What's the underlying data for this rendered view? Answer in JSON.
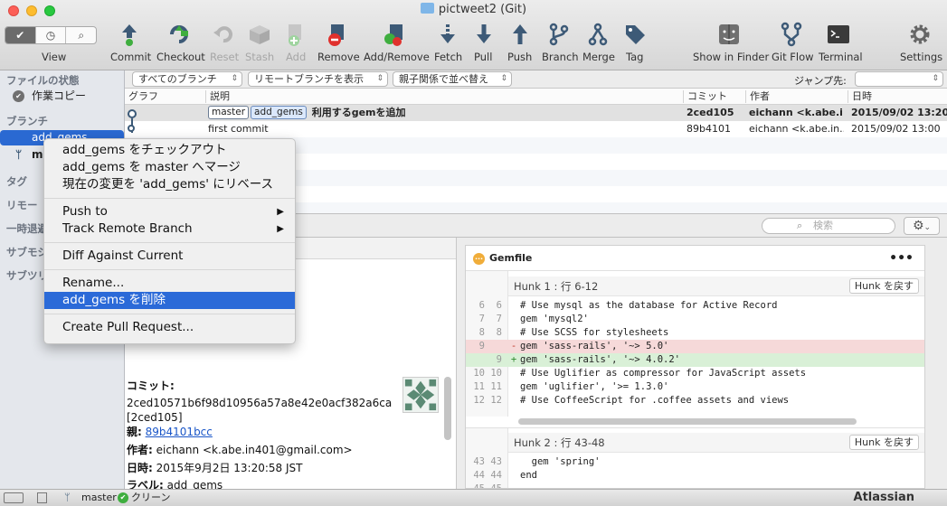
{
  "window": {
    "title": "pictweet2 (Git)"
  },
  "toolbar": {
    "view_segments": [
      "✔",
      "◷",
      "⌕"
    ],
    "view_label": "View",
    "items": [
      {
        "label": "Commit",
        "icon": "commit-icon",
        "enabled": true
      },
      {
        "label": "Checkout",
        "icon": "checkout-icon",
        "enabled": true
      },
      {
        "label": "Reset",
        "icon": "reset-icon",
        "enabled": false
      },
      {
        "label": "Stash",
        "icon": "stash-icon",
        "enabled": false
      },
      {
        "label": "Add",
        "icon": "add-icon",
        "enabled": false
      },
      {
        "label": "Remove",
        "icon": "remove-icon",
        "enabled": true
      },
      {
        "label": "Add/Remove",
        "icon": "add-remove-icon",
        "enabled": true
      },
      {
        "label": "Fetch",
        "icon": "fetch-icon",
        "enabled": true
      },
      {
        "label": "Pull",
        "icon": "pull-icon",
        "enabled": true
      },
      {
        "label": "Push",
        "icon": "push-icon",
        "enabled": true
      },
      {
        "label": "Branch",
        "icon": "branch-icon",
        "enabled": true
      },
      {
        "label": "Merge",
        "icon": "merge-icon",
        "enabled": true
      },
      {
        "label": "Tag",
        "icon": "tag-icon",
        "enabled": true
      }
    ],
    "right_items": [
      {
        "label": "Show in Finder",
        "icon": "finder-icon"
      },
      {
        "label": "Git Flow",
        "icon": "git-flow-icon"
      },
      {
        "label": "Terminal",
        "icon": "terminal-icon"
      },
      {
        "label": "Settings",
        "icon": "gear-icon"
      }
    ]
  },
  "filters": {
    "branches": "すべてのブランチ",
    "remote": "リモートブランチを表示",
    "order": "親子関係で並べ替え",
    "jump_label": "ジャンプ先:"
  },
  "sidebar": {
    "file_status": "ファイルの状態",
    "working_copy": "作業コピー",
    "branches": "ブランチ",
    "branch_items": [
      "add_gems",
      "ma"
    ],
    "tags": "タグ",
    "remotes": "リモー",
    "stashes": "一時退避",
    "submodules": "サブモジ",
    "subtrees": "サブツリ"
  },
  "columns": {
    "graph": "グラフ",
    "description": "説明",
    "commit": "コミット",
    "author": "作者",
    "date": "日時"
  },
  "commits": [
    {
      "tags": [
        "master",
        "add_gems"
      ],
      "description": "利用するgemを追加",
      "hash": "2ced105",
      "author": "eichann <k.abe.i...",
      "date": "2015/09/02 13:20"
    },
    {
      "tags": [],
      "description": "first commit",
      "hash": "89b4101",
      "author": "eichann <k.abe.in...",
      "date": "2015/09/02 13:00"
    }
  ],
  "search": {
    "placeholder": "検索"
  },
  "details": {
    "commit_label": "コミット:",
    "commit_hash": "2ced10571b6f98d10956a57a8e42e0acf382a6ca",
    "short_hash": "[2ced105]",
    "parent_label": "親:",
    "parent": "89b4101bcc",
    "author_label": "作者:",
    "author": "eichann <k.abe.in401@gmail.com>",
    "date_label": "日時:",
    "date": "2015年9月2日 13:20:58 JST",
    "labels_label": "ラベル:",
    "labels": "add_gems"
  },
  "diff": {
    "file": "Gemfile",
    "hunks": [
      {
        "title": "Hunk 1 : 行 6-12",
        "button": "Hunk を戻す",
        "lines": [
          {
            "old": "6",
            "new": "6",
            "mark": "",
            "text": "# Use mysql as the database for Active Record",
            "type": "ctx"
          },
          {
            "old": "7",
            "new": "7",
            "mark": "",
            "text": "gem 'mysql2'",
            "type": "ctx"
          },
          {
            "old": "8",
            "new": "8",
            "mark": "",
            "text": "# Use SCSS for stylesheets",
            "type": "ctx"
          },
          {
            "old": "9",
            "new": "",
            "mark": "-",
            "text": "gem 'sass-rails', '~> 5.0'",
            "type": "del"
          },
          {
            "old": "",
            "new": "9",
            "mark": "+",
            "text": "gem 'sass-rails', '~> 4.0.2'",
            "type": "add"
          },
          {
            "old": "10",
            "new": "10",
            "mark": "",
            "text": "# Use Uglifier as compressor for JavaScript assets",
            "type": "ctx"
          },
          {
            "old": "11",
            "new": "11",
            "mark": "",
            "text": "gem 'uglifier', '>= 1.3.0'",
            "type": "ctx"
          },
          {
            "old": "12",
            "new": "12",
            "mark": "",
            "text": "# Use CoffeeScript for .coffee assets and views",
            "type": "ctx"
          }
        ]
      },
      {
        "title": "Hunk 2 : 行 43-48",
        "button": "Hunk を戻す",
        "lines": [
          {
            "old": "43",
            "new": "43",
            "mark": "",
            "text": "  gem 'spring'",
            "type": "ctx"
          },
          {
            "old": "44",
            "new": "44",
            "mark": "",
            "text": "end",
            "type": "ctx"
          },
          {
            "old": "45",
            "new": "45",
            "mark": "",
            "text": "",
            "type": "ctx"
          }
        ]
      }
    ]
  },
  "context_menu": {
    "items": [
      {
        "label": "add_gems をチェックアウト"
      },
      {
        "label": "add_gems を master へマージ"
      },
      {
        "label": "現在の変更を 'add_gems' にリベース"
      },
      {
        "sep": true
      },
      {
        "label": "Push to",
        "submenu": true
      },
      {
        "label": "Track Remote Branch",
        "submenu": true
      },
      {
        "sep": true
      },
      {
        "label": "Diff Against Current"
      },
      {
        "sep": true
      },
      {
        "label": "Rename..."
      },
      {
        "label": "add_gems を削除",
        "highlighted": true
      },
      {
        "sep": true
      },
      {
        "label": "Create Pull Request..."
      }
    ]
  },
  "status": {
    "branch": "master",
    "state": "クリーン",
    "brand": "Atlassian"
  },
  "colors": {
    "accent": "#2b6ad8",
    "toolbar_icon": "#3d5a77",
    "disabled": "#a6a6a6",
    "deleted_bg": "#f6d9d9",
    "added_bg": "#d9f0d7"
  }
}
